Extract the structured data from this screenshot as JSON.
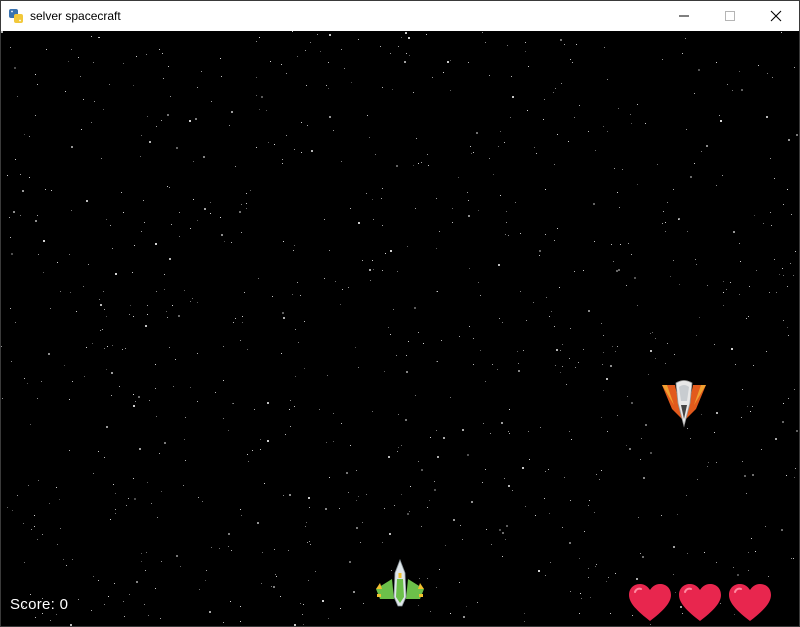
{
  "window": {
    "title": "selver spacecraft",
    "app_icon": "python-icon",
    "controls": [
      "minimize-icon",
      "maximize-icon",
      "close-icon"
    ]
  },
  "game": {
    "background_color": "#000000",
    "star_color": "#d8d8d8",
    "score_label": "Score: 0",
    "score": 0,
    "lives": 3,
    "player": {
      "sprite": "player-spaceship-icon",
      "colors": {
        "hull": "#dfe6ea",
        "wings": "#6cc04a",
        "accent": "#f2c12e"
      }
    },
    "enemies": [
      {
        "sprite": "enemy-spaceship-icon",
        "colors": {
          "hull": "#e8e8e8",
          "wings": "#e25a1c",
          "accent": "#f0a030"
        }
      }
    ],
    "heart_color": "#e8264e"
  }
}
